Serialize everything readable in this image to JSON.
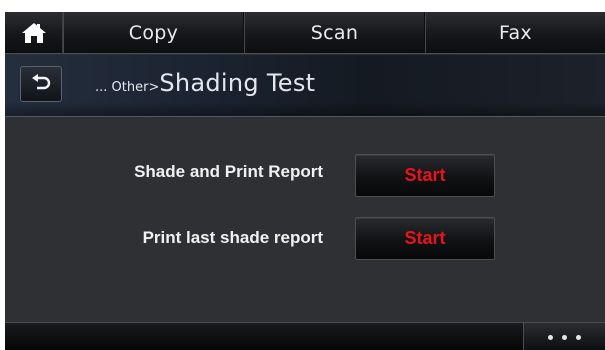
{
  "nav": {
    "home_icon": "home-icon",
    "tabs": [
      {
        "label": "Copy"
      },
      {
        "label": "Scan"
      },
      {
        "label": "Fax"
      }
    ]
  },
  "titlebar": {
    "back_icon": "back-arrow-icon",
    "breadcrumb_prefix": "... Other>",
    "title": "Shading Test"
  },
  "actions": [
    {
      "label": "Shade and Print Report",
      "button_label": "Start"
    },
    {
      "label": "Print last shade report",
      "button_label": "Start"
    }
  ],
  "bottombar": {
    "more_icon": "more-options-icon"
  },
  "colors": {
    "start_text": "#e8141c",
    "background": "#2e3034"
  }
}
